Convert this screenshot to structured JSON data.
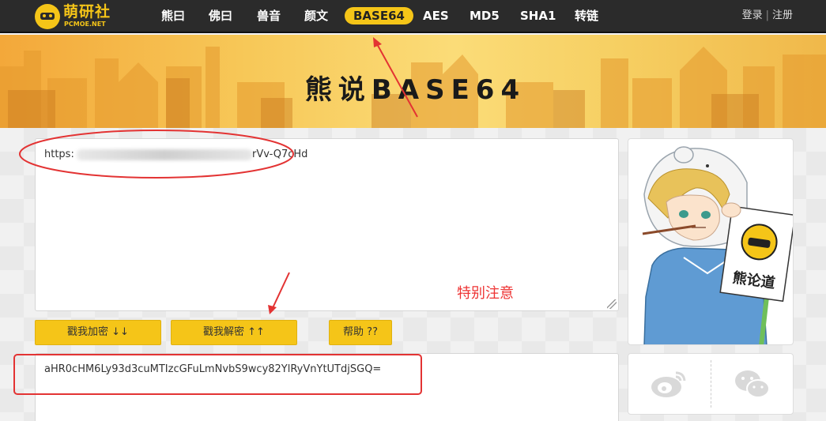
{
  "site": {
    "logo_name": "萌研社",
    "logo_sub": "PCMOE.NET"
  },
  "nav": {
    "items": [
      {
        "label": "熊曰"
      },
      {
        "label": "佛曰"
      },
      {
        "label": "兽音"
      },
      {
        "label": "颜文"
      },
      {
        "label": "BASE64"
      },
      {
        "label": "AES"
      },
      {
        "label": "MD5"
      },
      {
        "label": "SHA1"
      },
      {
        "label": "转链"
      }
    ],
    "active": "BASE64",
    "login": "登录",
    "separator": "|",
    "register": "注册"
  },
  "banner": {
    "title": "熊说BASE64"
  },
  "input": {
    "value_start": "https:",
    "value_end": "rVv-Q7cHd"
  },
  "buttons": {
    "encrypt": "戳我加密 ↓↓",
    "decrypt": "戳我解密 ↑↑",
    "help": "帮助 ??"
  },
  "output": {
    "value": "aHR0cHM6Ly93d3cuMTIzcGFuLmNvbS9wcy82YlRyVnYtUTdjSGQ="
  },
  "sidebar": {
    "sign_text": "熊论道"
  },
  "share": {
    "icons": [
      "weibo-icon",
      "wechat-icon"
    ]
  },
  "annotation": {
    "text": "特别注意"
  },
  "colors": {
    "accent": "#f5c518",
    "navbar": "#2b2b2b",
    "annotation": "#e33333"
  }
}
